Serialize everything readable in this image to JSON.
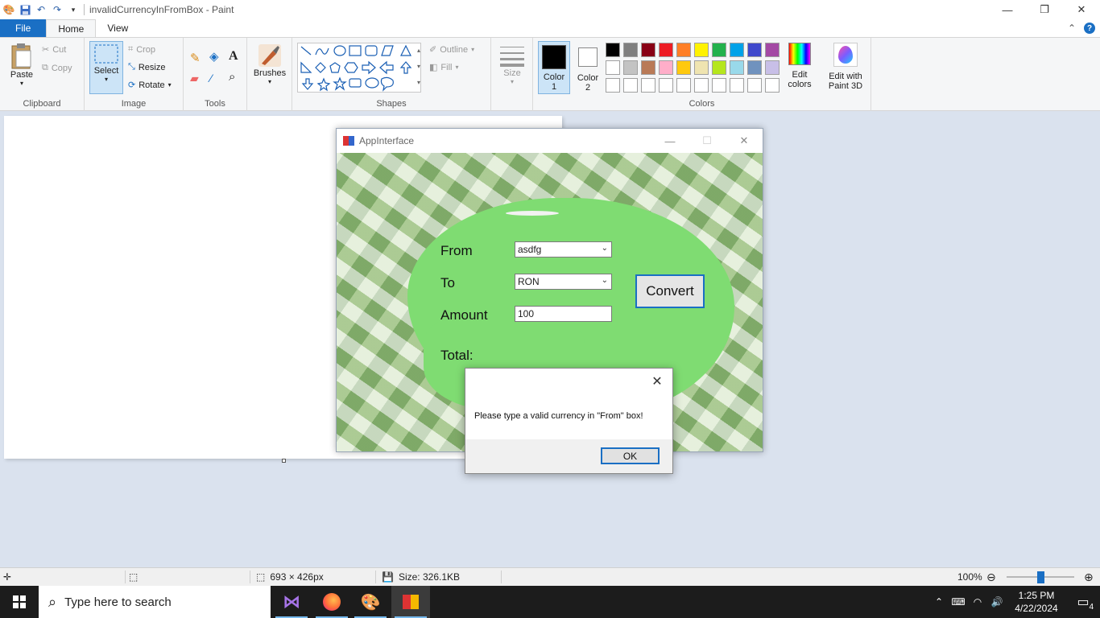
{
  "titlebar": {
    "doc_title": "invalidCurrencyInFromBox - Paint",
    "minimize": "—",
    "maximize": "❐",
    "close": "✕"
  },
  "tabs": [
    {
      "label": "File"
    },
    {
      "label": "Home"
    },
    {
      "label": "View"
    }
  ],
  "ribbon": {
    "clipboard": {
      "paste": "Paste",
      "cut": "Cut",
      "copy": "Copy",
      "label": "Clipboard"
    },
    "image": {
      "select": "Select",
      "crop": "Crop",
      "resize": "Resize",
      "rotate": "Rotate",
      "label": "Image"
    },
    "tools": {
      "label": "Tools"
    },
    "brushes": {
      "label": "Brushes"
    },
    "shapes": {
      "outline": "Outline",
      "fill": "Fill",
      "label": "Shapes"
    },
    "size": {
      "label": "Size"
    },
    "colors": {
      "color1": "Color\n1",
      "color1_a": "Color",
      "color1_b": "1",
      "color2_a": "Color",
      "color2_b": "2",
      "edit_a": "Edit",
      "edit_b": "colors",
      "paint3d_a": "Edit with",
      "paint3d_b": "Paint 3D",
      "label": "Colors",
      "color1_value": "#000000",
      "color2_value": "#ffffff",
      "palette_row1": [
        "#000000",
        "#7f7f7f",
        "#880015",
        "#ed1c24",
        "#ff7f27",
        "#fff200",
        "#22b14c",
        "#00a2e8",
        "#3f48cc",
        "#a349a4"
      ],
      "palette_row2": [
        "#ffffff",
        "#c3c3c3",
        "#b97a57",
        "#ffaec9",
        "#ffc90e",
        "#efe4b0",
        "#b5e61d",
        "#99d9ea",
        "#7092be",
        "#c8bfe7"
      ],
      "palette_row3": [
        "#ffffff",
        "#ffffff",
        "#ffffff",
        "#ffffff",
        "#ffffff",
        "#ffffff",
        "#ffffff",
        "#ffffff",
        "#ffffff",
        "#ffffff"
      ]
    }
  },
  "app": {
    "title": "AppInterface",
    "from_label": "From",
    "to_label": "To",
    "amount_label": "Amount",
    "total_label": "Total:",
    "from_value": "asdfg",
    "to_value": "RON",
    "amount_value": "100",
    "convert_label": "Convert"
  },
  "dialog": {
    "message": "Please type a valid currency in \"From\" box!",
    "ok_label": "OK"
  },
  "statusbar": {
    "dimensions": "693 × 426px",
    "size": "Size: 326.1KB",
    "zoom": "100%"
  },
  "taskbar": {
    "search_placeholder": "Type here to search",
    "time": "1:25 PM",
    "date": "4/22/2024",
    "notifications": "4"
  }
}
